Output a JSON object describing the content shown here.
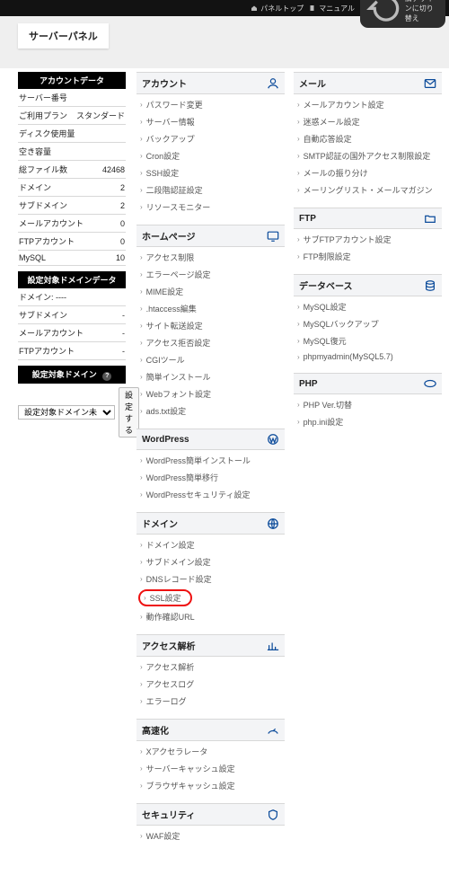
{
  "topbar": {
    "links": [
      {
        "icon": "home",
        "label": "パネルトップ"
      },
      {
        "icon": "book",
        "label": "マニュアル"
      }
    ],
    "chip": {
      "icon": "revert",
      "label": "旧デザインに切り替え"
    }
  },
  "page_title": "サーバーパネル",
  "sidebar": {
    "account": {
      "title": "アカウントデータ",
      "rows": [
        {
          "label": "サーバー番号",
          "value": null,
          "mask": true
        },
        {
          "label": "ご利用プラン",
          "value": "スタンダード"
        },
        {
          "label": "ディスク使用量",
          "value": null,
          "mask": true
        },
        {
          "label": "空き容量",
          "value": null,
          "mask": true
        },
        {
          "label": "総ファイル数",
          "value": "42468"
        },
        {
          "label": "ドメイン",
          "value": "2"
        },
        {
          "label": "サブドメイン",
          "value": "2"
        },
        {
          "label": "メールアカウント",
          "value": "0"
        },
        {
          "label": "FTPアカウント",
          "value": "0"
        },
        {
          "label": "MySQL",
          "value": "10"
        }
      ]
    },
    "domain_data": {
      "title": "設定対象ドメインデータ",
      "rows": [
        {
          "label": "ドメイン: ----",
          "value": ""
        },
        {
          "label": "サブドメイン",
          "value": "-"
        },
        {
          "label": "メールアカウント",
          "value": "-"
        },
        {
          "label": "FTPアカウント",
          "value": "-"
        }
      ]
    },
    "domain_select": {
      "title": "設定対象ドメイン",
      "option": "設定対象ドメイン未",
      "button": "設定する"
    }
  },
  "left_sections": [
    {
      "key": "account",
      "title": "アカウント",
      "icon": "user",
      "items": [
        "パスワード変更",
        "サーバー情報",
        "バックアップ",
        "Cron設定",
        "SSH設定",
        "二段階認証設定",
        "リソースモニター"
      ]
    },
    {
      "key": "homepage",
      "title": "ホームページ",
      "icon": "monitor",
      "items": [
        "アクセス制限",
        "エラーページ設定",
        "MIME設定",
        ".htaccess編集",
        "サイト転送設定",
        "アクセス拒否設定",
        "CGIツール",
        "簡単インストール",
        "Webフォント設定",
        "ads.txt設定"
      ]
    },
    {
      "key": "wordpress",
      "title": "WordPress",
      "icon": "wp",
      "items": [
        "WordPress簡単インストール",
        "WordPress簡単移行",
        "WordPressセキュリティ設定"
      ]
    },
    {
      "key": "domain",
      "title": "ドメイン",
      "icon": "globe",
      "items": [
        "ドメイン設定",
        "サブドメイン設定",
        "DNSレコード設定",
        {
          "label": "SSL設定",
          "highlight": true
        },
        "動作確認URL"
      ]
    },
    {
      "key": "access",
      "title": "アクセス解析",
      "icon": "chart",
      "items": [
        "アクセス解析",
        "アクセスログ",
        "エラーログ"
      ]
    },
    {
      "key": "speed",
      "title": "高速化",
      "icon": "speed",
      "items": [
        "Xアクセラレータ",
        "サーバーキャッシュ設定",
        "ブラウザキャッシュ設定"
      ]
    },
    {
      "key": "security",
      "title": "セキュリティ",
      "icon": "shield",
      "items": [
        "WAF設定"
      ]
    }
  ],
  "right_sections": [
    {
      "key": "mail",
      "title": "メール",
      "icon": "mail",
      "items": [
        "メールアカウント設定",
        "迷惑メール設定",
        "自動応答設定",
        "SMTP認証の国外アクセス制限設定",
        "メールの振り分け",
        "メーリングリスト・メールマガジン"
      ]
    },
    {
      "key": "ftp",
      "title": "FTP",
      "icon": "folder",
      "items": [
        "サブFTPアカウント設定",
        "FTP制限設定"
      ]
    },
    {
      "key": "db",
      "title": "データベース",
      "icon": "db",
      "items": [
        "MySQL設定",
        "MySQLバックアップ",
        "MySQL復元",
        "phpmyadmin(MySQL5.7)"
      ]
    },
    {
      "key": "php",
      "title": "PHP",
      "icon": "php",
      "items": [
        "PHP Ver.切替",
        "php.ini設定"
      ]
    }
  ]
}
